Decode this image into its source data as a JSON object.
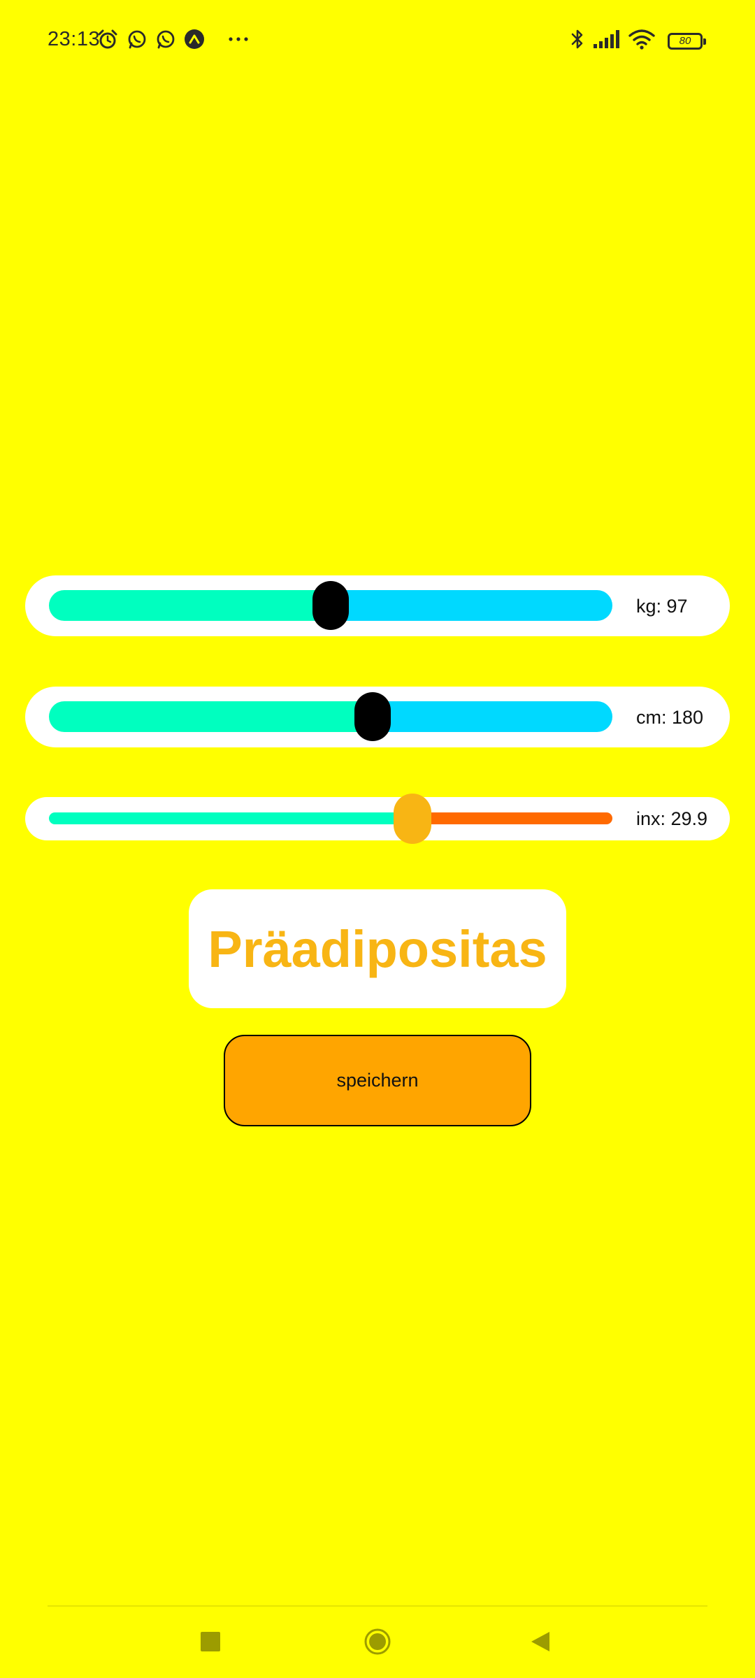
{
  "status_bar": {
    "time": "23:13",
    "battery_level": "80",
    "icons": [
      "alarm-icon",
      "whatsapp-icon",
      "whatsapp-icon",
      "app-notification-icon",
      "more-notifications-icon",
      "bluetooth-icon",
      "signal-icon",
      "wifi-icon",
      "battery-icon"
    ]
  },
  "sliders": {
    "weight": {
      "label": "kg: 97",
      "position": 0.5,
      "fill_color": "#00ffbf",
      "track_color": "#00d9ff",
      "thumb_color": "#000000"
    },
    "height": {
      "label": "cm: 180",
      "position": 0.575,
      "fill_color": "#00ffbf",
      "track_color": "#00d9ff",
      "thumb_color": "#000000"
    },
    "index": {
      "label": "inx: 29.9",
      "position": 0.645,
      "fill_color": "#00ffbf",
      "track_color": "#ff6a00",
      "thumb_color": "#f8b514"
    }
  },
  "result": {
    "text": "Präadipositas",
    "color": "#f8b514"
  },
  "save_button": {
    "label": "speichern",
    "color": "#ffa500"
  },
  "nav_bar": {
    "icons": [
      "recent-apps-icon",
      "home-icon",
      "back-icon"
    ]
  },
  "colors": {
    "background": "#ffff00"
  }
}
